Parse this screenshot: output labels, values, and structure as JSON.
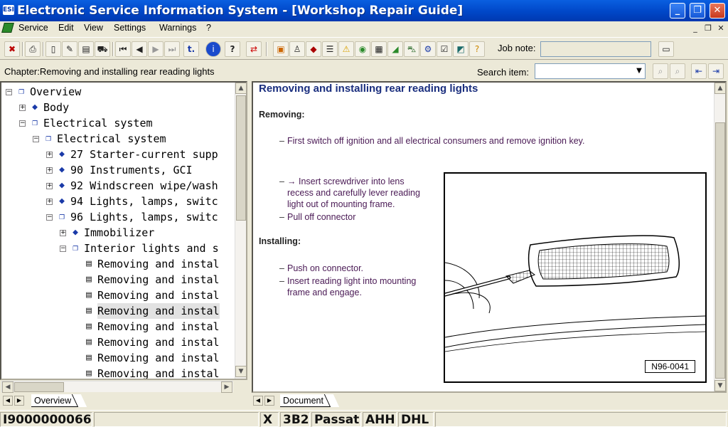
{
  "window": {
    "title": "Electronic Service Information System - [Workshop Repair Guide]",
    "app_icon_label": "ESI",
    "buttons": {
      "minimize": "_",
      "maximize": "❐",
      "close": "✕"
    }
  },
  "menubar": {
    "items": [
      "Service",
      "Edit",
      "View",
      "Settings",
      "Warnings",
      "?"
    ],
    "mdi_buttons": [
      "_",
      "❐",
      "✕"
    ]
  },
  "toolbar": {
    "icons": [
      "exit-icon",
      "print-icon",
      "new-document-icon",
      "edit-document-icon",
      "notes-icon",
      "vehicle-icon",
      "first-icon",
      "previous-icon",
      "next-icon",
      "last-icon",
      "back-link-icon",
      "info-icon",
      "help-icon",
      "swap-icon",
      "toolbox-icon",
      "person-icon",
      "manual-icon",
      "list-icon",
      "warning-icon",
      "globe-icon",
      "calculator-icon",
      "book-green-icon",
      "car-icon",
      "engine-icon",
      "checklist-icon",
      "diagnosis-icon",
      "help-pointer-icon"
    ],
    "job_note_label": "Job note:",
    "job_note_value": ""
  },
  "chapter": {
    "text": "Chapter:Removing and installing rear reading lights",
    "search_label": "Search item:",
    "search_value": ""
  },
  "tree": {
    "rows": [
      {
        "label": "Overview",
        "indent": 0,
        "icon": "open",
        "expander": "−"
      },
      {
        "label": "Body",
        "indent": 1,
        "icon": "book",
        "expander": "+"
      },
      {
        "label": "Electrical system",
        "indent": 1,
        "icon": "open",
        "expander": "−"
      },
      {
        "label": "Electrical system",
        "indent": 2,
        "icon": "open",
        "expander": "−"
      },
      {
        "label": "27 Starter-current supp",
        "indent": 3,
        "icon": "book",
        "expander": "+"
      },
      {
        "label": "90 Instruments, GCI",
        "indent": 3,
        "icon": "book",
        "expander": "+"
      },
      {
        "label": "92 Windscreen wipe/wash",
        "indent": 3,
        "icon": "book",
        "expander": "+"
      },
      {
        "label": "94 Lights, lamps, switc",
        "indent": 3,
        "icon": "book",
        "expander": "+"
      },
      {
        "label": "96 Lights, lamps, switc",
        "indent": 3,
        "icon": "open",
        "expander": "−"
      },
      {
        "label": "Immobilizer",
        "indent": 4,
        "icon": "book",
        "expander": "+"
      },
      {
        "label": "Interior lights and s",
        "indent": 4,
        "icon": "open",
        "expander": "−"
      },
      {
        "label": "Removing and instal",
        "indent": 5,
        "icon": "page",
        "expander": ""
      },
      {
        "label": "Removing and instal",
        "indent": 5,
        "icon": "page",
        "expander": ""
      },
      {
        "label": "Removing and instal",
        "indent": 5,
        "icon": "page",
        "expander": ""
      },
      {
        "label": "Removing and instal",
        "indent": 5,
        "icon": "page",
        "expander": "",
        "selected": true
      },
      {
        "label": "Removing and instal",
        "indent": 5,
        "icon": "page",
        "expander": ""
      },
      {
        "label": "Removing and instal",
        "indent": 5,
        "icon": "page",
        "expander": ""
      },
      {
        "label": "Removing and instal",
        "indent": 5,
        "icon": "page",
        "expander": ""
      },
      {
        "label": "Removing and instal",
        "indent": 5,
        "icon": "page",
        "expander": ""
      }
    ],
    "tab_label": "Overview"
  },
  "document": {
    "title": "Removing and installing rear reading lights",
    "removing_heading": "Removing:",
    "step1": "First switch off ignition and all electrical consumers and remove ignition key.",
    "step2_line1": "→ Insert screwdriver into lens",
    "step2_line2": "recess and carefully lever reading",
    "step2_line3": "light out of mounting frame.",
    "step3": "Pull off connector",
    "installing_heading": "Installing:",
    "step4": "Push on connector.",
    "step5_line1": "Insert reading light into mounting",
    "step5_line2": "frame and engage.",
    "dash": "–",
    "figure_caption": "N96-0041",
    "tab_label": "Document"
  },
  "statusbar": {
    "fields": [
      "I9000000066",
      "",
      "X",
      "3B2",
      "Passat",
      "AHH",
      "DHL",
      ""
    ]
  }
}
